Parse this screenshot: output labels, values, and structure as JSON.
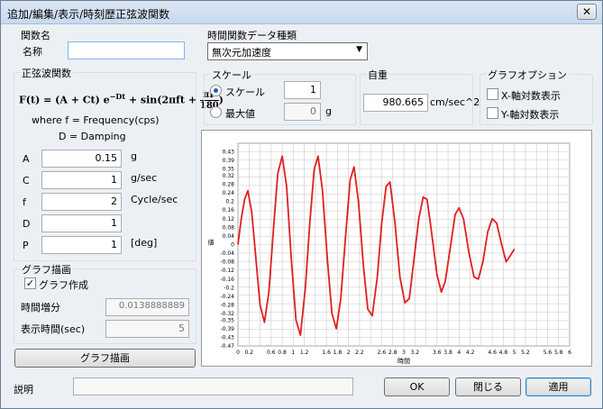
{
  "window": {
    "title": "追加/編集/表示/時刻歴正弦波関数",
    "close_glyph": "✕"
  },
  "name_group": {
    "title": "関数名",
    "name_label": "名称",
    "name_value": ""
  },
  "sine_group": {
    "title": "正弦波関数",
    "formula": {
      "lhs": "F(t) = (A + Ct) e",
      "exp": "−Dt",
      "mid": " + sin(2πft + ",
      "num": "πP",
      "den": "180",
      ")": ")"
    },
    "where": "where f = Frequency(cps)",
    "damping": "D = Damping",
    "params": [
      {
        "label": "A",
        "value": "0.15",
        "unit": "g"
      },
      {
        "label": "C",
        "value": "1",
        "unit": "g/sec"
      },
      {
        "label": "f",
        "value": "2",
        "unit": "Cycle/sec"
      },
      {
        "label": "D",
        "value": "1",
        "unit": ""
      },
      {
        "label": "P",
        "value": "1",
        "unit": "[deg]"
      }
    ]
  },
  "graph_draw_group": {
    "title": "グラフ描画",
    "make_graph_label": "グラフ作成",
    "make_graph_checked": true,
    "time_step_label": "時間増分",
    "time_step_value": "0.0138888889",
    "display_time_label": "表示時間(sec)",
    "display_time_value": "5"
  },
  "graph_draw_button": "グラフ描画",
  "data_type": {
    "title": "時間関数データ種類",
    "selected": "無次元加速度"
  },
  "scale": {
    "title": "スケール",
    "option_scale": "スケール",
    "scale_value": "1",
    "option_max": "最大値",
    "max_value": "0",
    "max_unit": "g",
    "selected": "scale"
  },
  "self_weight": {
    "title": "自重",
    "value": "980.665",
    "unit": "cm/sec^2"
  },
  "graph_options": {
    "title": "グラフオプション",
    "x_log": "X-軸対数表示",
    "y_log": "Y-軸対数表示",
    "x_log_checked": false,
    "y_log_checked": false
  },
  "description": {
    "label": "説明",
    "value": ""
  },
  "buttons": {
    "ok": "OK",
    "close": "閉じる",
    "apply": "適用"
  },
  "colors": {
    "series": "#e0201e",
    "grid": "#c8c8c8"
  },
  "chart_data": {
    "type": "line",
    "xlabel": "時間",
    "ylabel": "値",
    "xlim": [
      0,
      6
    ],
    "ylim": [
      -0.47,
      0.47
    ],
    "x_ticks": [
      0,
      0.2,
      0.6,
      0.8,
      1,
      1.2,
      1.6,
      1.8,
      2,
      2.2,
      2.6,
      2.8,
      3,
      3.2,
      3.6,
      3.8,
      4,
      4.2,
      4.6,
      4.8,
      5,
      5.2,
      5.6,
      5.8,
      6
    ],
    "y_ticks": [
      0.43,
      0.39,
      0.35,
      0.32,
      0.28,
      0.24,
      0.2,
      0.16,
      0.12,
      0.08,
      0.04,
      0,
      -0.04,
      -0.08,
      -0.12,
      -0.16,
      -0.2,
      -0.24,
      -0.28,
      -0.32,
      -0.35,
      -0.39,
      -0.43,
      -0.47
    ],
    "series": [
      {
        "formula": "(A+C*t)*exp(-D*t)+sin(2*pi*f*t+pi*P/180) scaled to plot",
        "x_start": 0,
        "x_end": 5,
        "points": [
          [
            0,
            0.0
          ],
          [
            0.06,
            0.12
          ],
          [
            0.12,
            0.21
          ],
          [
            0.18,
            0.25
          ],
          [
            0.25,
            0.15
          ],
          [
            0.32,
            -0.05
          ],
          [
            0.4,
            -0.28
          ],
          [
            0.48,
            -0.36
          ],
          [
            0.56,
            -0.22
          ],
          [
            0.65,
            0.1
          ],
          [
            0.72,
            0.33
          ],
          [
            0.8,
            0.41
          ],
          [
            0.88,
            0.27
          ],
          [
            0.96,
            -0.05
          ],
          [
            1.05,
            -0.35
          ],
          [
            1.13,
            -0.42
          ],
          [
            1.22,
            -0.2
          ],
          [
            1.3,
            0.1
          ],
          [
            1.38,
            0.35
          ],
          [
            1.45,
            0.41
          ],
          [
            1.53,
            0.25
          ],
          [
            1.62,
            -0.08
          ],
          [
            1.7,
            -0.32
          ],
          [
            1.78,
            -0.39
          ],
          [
            1.86,
            -0.25
          ],
          [
            1.95,
            0.05
          ],
          [
            2.03,
            0.3
          ],
          [
            2.1,
            0.36
          ],
          [
            2.18,
            0.2
          ],
          [
            2.27,
            -0.1
          ],
          [
            2.35,
            -0.3
          ],
          [
            2.43,
            -0.33
          ],
          [
            2.52,
            -0.15
          ],
          [
            2.6,
            0.1
          ],
          [
            2.68,
            0.27
          ],
          [
            2.75,
            0.29
          ],
          [
            2.84,
            0.1
          ],
          [
            2.93,
            -0.15
          ],
          [
            3.02,
            -0.27
          ],
          [
            3.1,
            -0.25
          ],
          [
            3.18,
            -0.08
          ],
          [
            3.27,
            0.12
          ],
          [
            3.35,
            0.22
          ],
          [
            3.42,
            0.21
          ],
          [
            3.5,
            0.06
          ],
          [
            3.6,
            -0.14
          ],
          [
            3.68,
            -0.22
          ],
          [
            3.75,
            -0.17
          ],
          [
            3.85,
            0.0
          ],
          [
            3.93,
            0.14
          ],
          [
            4.0,
            0.17
          ],
          [
            4.08,
            0.12
          ],
          [
            4.18,
            -0.04
          ],
          [
            4.27,
            -0.15
          ],
          [
            4.35,
            -0.16
          ],
          [
            4.43,
            -0.08
          ],
          [
            4.52,
            0.06
          ],
          [
            4.6,
            0.12
          ],
          [
            4.68,
            0.1
          ],
          [
            4.77,
            0.0
          ],
          [
            4.85,
            -0.08
          ],
          [
            4.93,
            -0.05
          ],
          [
            5.0,
            -0.02
          ]
        ]
      }
    ]
  }
}
